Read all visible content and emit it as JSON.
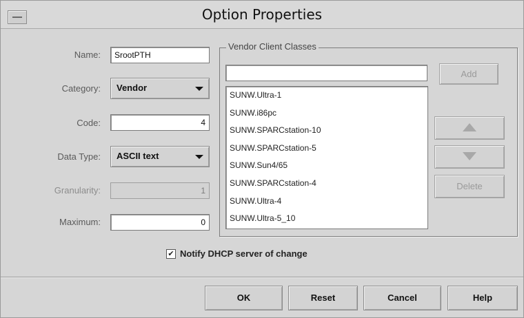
{
  "window": {
    "title": "Option Properties"
  },
  "form": {
    "name_label": "Name:",
    "name_value": "SrootPTH",
    "category_label": "Category:",
    "category_value": "Vendor",
    "code_label": "Code:",
    "code_value": "4",
    "datatype_label": "Data Type:",
    "datatype_value": "ASCII text",
    "granularity_label": "Granularity:",
    "granularity_value": "1",
    "maximum_label": "Maximum:",
    "maximum_value": "0"
  },
  "vendor": {
    "group_title": "Vendor Client Classes",
    "input_value": "",
    "add_label": "Add",
    "delete_label": "Delete",
    "items": [
      "SUNW.Ultra-1",
      "SUNW.i86pc",
      "SUNW.SPARCstation-10",
      "SUNW.SPARCstation-5",
      "SUNW.Sun4/65",
      "SUNW.SPARCstation-4",
      "SUNW.Ultra-4",
      "SUNW.Ultra-5_10"
    ]
  },
  "notify": {
    "checked_mark": "✔",
    "label": "Notify DHCP server of change"
  },
  "footer": {
    "ok": "OK",
    "reset": "Reset",
    "cancel": "Cancel",
    "help": "Help"
  }
}
